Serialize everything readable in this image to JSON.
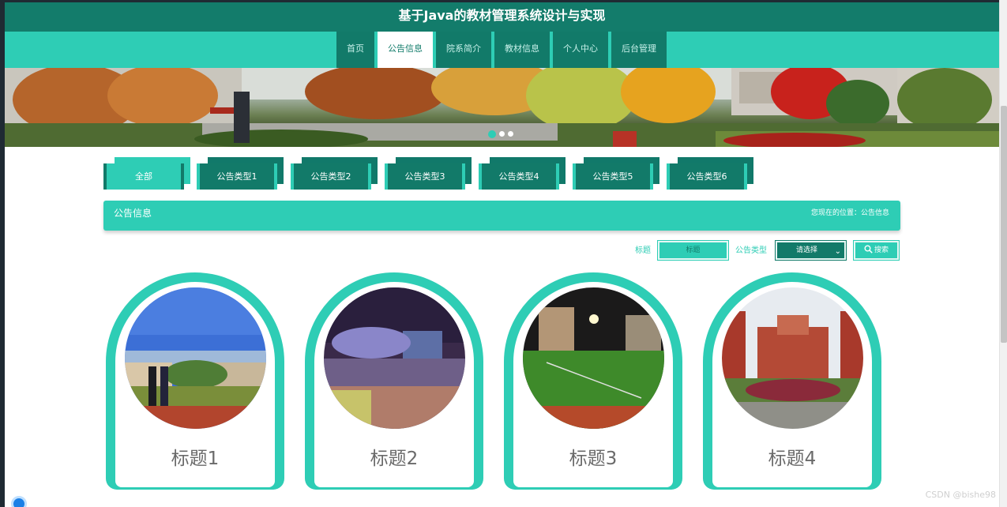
{
  "site": {
    "title": "基于Java的教材管理系统设计与实现"
  },
  "nav": {
    "items": [
      {
        "label": "首页"
      },
      {
        "label": "公告信息"
      },
      {
        "label": "院系简介"
      },
      {
        "label": "教材信息"
      },
      {
        "label": "个人中心"
      },
      {
        "label": "后台管理"
      }
    ],
    "active_index": 1
  },
  "banner": {
    "dot_count": 3,
    "active_dot": 0
  },
  "categories": {
    "items": [
      {
        "label": "全部"
      },
      {
        "label": "公告类型1"
      },
      {
        "label": "公告类型2"
      },
      {
        "label": "公告类型3"
      },
      {
        "label": "公告类型4"
      },
      {
        "label": "公告类型5"
      },
      {
        "label": "公告类型6"
      }
    ],
    "active_index": 0
  },
  "section": {
    "title": "公告信息",
    "breadcrumb": "您现在的位置：公告信息"
  },
  "search": {
    "title_label": "标题",
    "title_placeholder": "标题",
    "type_label": "公告类型",
    "type_selected": "请选择",
    "button_label": "搜索"
  },
  "cards": [
    {
      "title": "标题1"
    },
    {
      "title": "标题2"
    },
    {
      "title": "标题3"
    },
    {
      "title": "标题4"
    }
  ],
  "watermark": "CSDN @bishe98",
  "colors": {
    "primary": "#2ecdb5",
    "dark": "#137c6b",
    "text_gray": "#6a6a6a"
  }
}
